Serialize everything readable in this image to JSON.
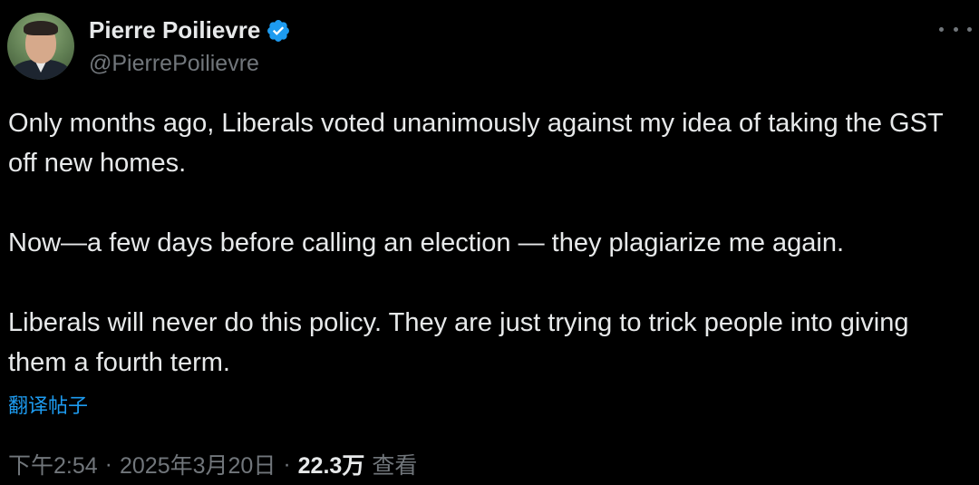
{
  "author": {
    "name": "Pierre Poilievre",
    "handle": "@PierrePoilievre",
    "verified": true,
    "verified_color": "#1d9bf0"
  },
  "post": {
    "paragraphs": [
      "Only months ago, Liberals voted unanimously against my idea of taking the GST off new homes.",
      "Now—a few days before calling an election — they plagiarize me again.",
      "Liberals will never do this policy. They are just trying to trick people into giving them a fourth term."
    ],
    "translate_link": "翻译帖子"
  },
  "meta": {
    "time": "下午2:54",
    "date": "2025年3月20日",
    "separator": "·",
    "views_count": "22.3万",
    "views_label": "查看"
  },
  "colors": {
    "background": "#000000",
    "text": "#e7e9ea",
    "muted": "#71767b",
    "link": "#1d9bf0"
  },
  "icons": {
    "more": "more-horizontal-icon",
    "verified": "verified-badge-icon"
  }
}
